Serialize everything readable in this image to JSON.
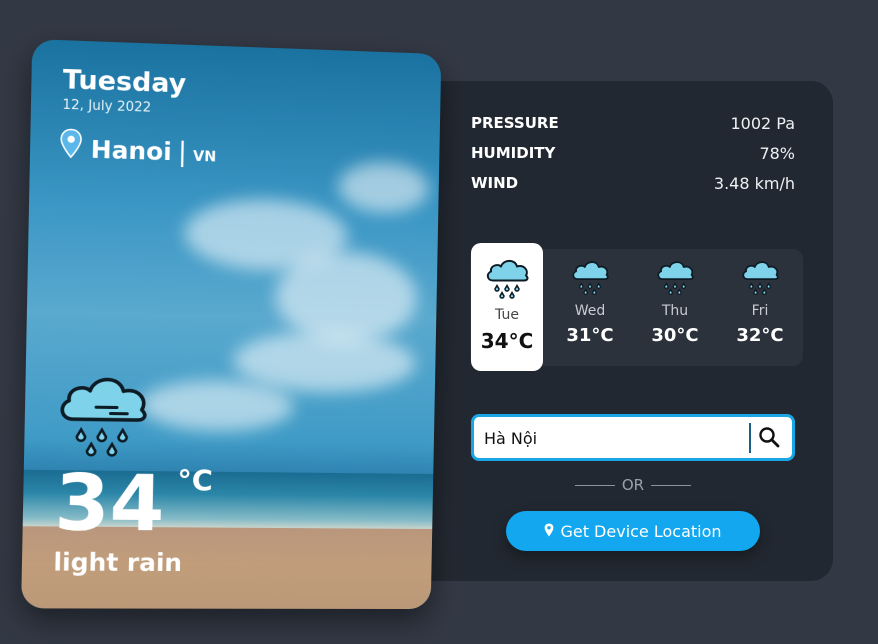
{
  "current": {
    "day": "Tuesday",
    "date": "12, July 2022",
    "city": "Hanoi",
    "separator": "|",
    "country": "VN",
    "temp": "34",
    "unit": "°C",
    "description": "light rain",
    "icon": "rain-cloud-icon"
  },
  "stats": [
    {
      "label": "PRESSURE",
      "value": "1002 Pa"
    },
    {
      "label": "HUMIDITY",
      "value": "78%"
    },
    {
      "label": "WIND",
      "value": "3.48 km/h"
    }
  ],
  "forecast": [
    {
      "day": "Tue",
      "temp": "34°C",
      "active": true,
      "icon": "rain-cloud-icon"
    },
    {
      "day": "Wed",
      "temp": "31°C",
      "active": false,
      "icon": "rain-cloud-icon"
    },
    {
      "day": "Thu",
      "temp": "30°C",
      "active": false,
      "icon": "rain-cloud-icon"
    },
    {
      "day": "Fri",
      "temp": "32°C",
      "active": false,
      "icon": "rain-cloud-icon"
    }
  ],
  "search": {
    "value": "Hà Nội",
    "icon": "search-icon"
  },
  "or_text": "OR",
  "location_button": {
    "label": "Get Device Location",
    "icon": "map-pin-icon"
  },
  "colors": {
    "background": "#323844",
    "panel": "#222831",
    "accent": "#12a7ef",
    "cloud": "#7ed3ea"
  }
}
